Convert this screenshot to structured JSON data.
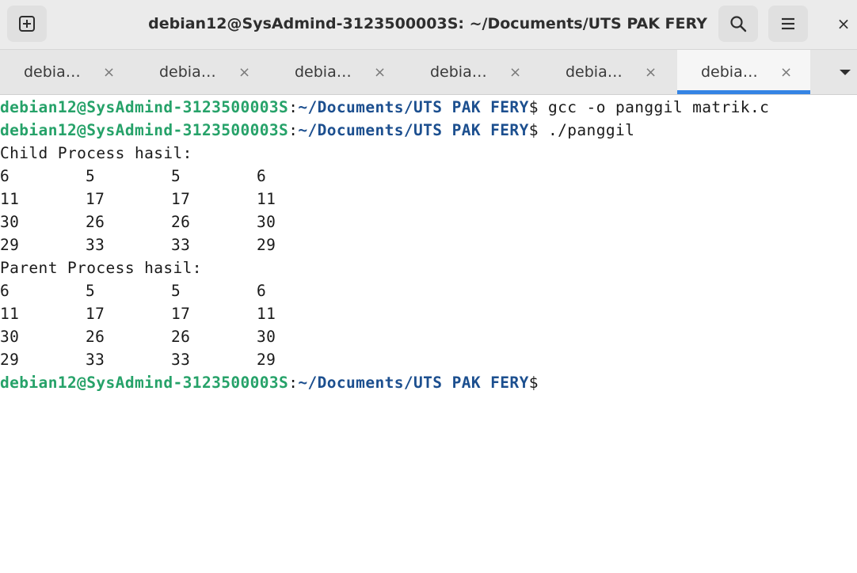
{
  "window": {
    "title": "debian12@SysAdmind-3123500003S: ~/Documents/UTS PAK FERY",
    "new_tab_icon": "plus-square-icon",
    "search_icon": "search-icon",
    "menu_icon": "hamburger-menu-icon",
    "close_glyph": "×"
  },
  "tabs": [
    {
      "label": "debia…",
      "close": "×",
      "active": false
    },
    {
      "label": "debia…",
      "close": "×",
      "active": false
    },
    {
      "label": "debia…",
      "close": "×",
      "active": false
    },
    {
      "label": "debia…",
      "close": "×",
      "active": false
    },
    {
      "label": "debia…",
      "close": "×",
      "active": false
    },
    {
      "label": "debia…",
      "close": "×",
      "active": true
    }
  ],
  "terminal": {
    "prompt": {
      "user_host": "debian12@SysAdmind-3123500003S",
      "colon": ":",
      "path": "~/Documents/UTS PAK FERY",
      "dollar": "$"
    },
    "commands": [
      " gcc -o panggil matrik.c",
      " ./panggil"
    ],
    "child_header": "Child Process hasil:",
    "child_matrix": [
      [
        "6",
        "5",
        "5",
        "6"
      ],
      [
        "11",
        "17",
        "17",
        "11"
      ],
      [
        "30",
        "26",
        "26",
        "30"
      ],
      [
        "29",
        "33",
        "33",
        "29"
      ]
    ],
    "parent_header": "Parent Process hasil:",
    "parent_matrix": [
      [
        "6",
        "5",
        "5",
        "6"
      ],
      [
        "11",
        "17",
        "17",
        "11"
      ],
      [
        "30",
        "26",
        "26",
        "30"
      ],
      [
        "29",
        "33",
        "33",
        "29"
      ]
    ]
  },
  "colors": {
    "prompt_user": "#26a269",
    "prompt_path": "#1c4f8f",
    "active_tab_indicator": "#3584e4"
  }
}
